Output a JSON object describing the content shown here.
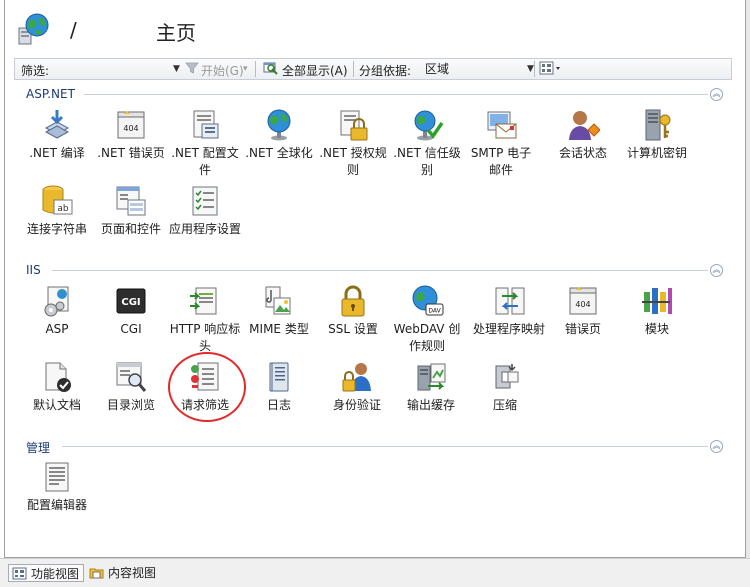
{
  "header": {
    "path": "/",
    "title": "主页"
  },
  "toolbar": {
    "filter_label": "筛选:",
    "go_label": "开始(G)",
    "show_all_label": "全部显示(A)",
    "group_by_label": "分组依据:",
    "group_by_value": "区域"
  },
  "sections": [
    {
      "title": "ASP.NET",
      "items": [
        {
          "label": ".NET 编译",
          "icon": "net-compile-icon"
        },
        {
          "label": ".NET 错误页",
          "icon": "net-error-pages-icon"
        },
        {
          "label": ".NET 配置文件",
          "icon": "net-profile-icon"
        },
        {
          "label": ".NET 全球化",
          "icon": "net-globalization-icon"
        },
        {
          "label": ".NET 授权规则",
          "icon": "net-authorization-icon"
        },
        {
          "label": ".NET 信任级别",
          "icon": "net-trust-levels-icon"
        },
        {
          "label": "SMTP 电子邮件",
          "icon": "smtp-email-icon"
        },
        {
          "label": "会话状态",
          "icon": "session-state-icon"
        },
        {
          "label": "计算机密钥",
          "icon": "machine-key-icon"
        },
        {
          "label": "连接字符串",
          "icon": "connection-strings-icon"
        },
        {
          "label": "页面和控件",
          "icon": "pages-controls-icon"
        },
        {
          "label": "应用程序设置",
          "icon": "app-settings-icon"
        }
      ]
    },
    {
      "title": "IIS",
      "items": [
        {
          "label": "ASP",
          "icon": "asp-icon"
        },
        {
          "label": "CGI",
          "icon": "cgi-icon"
        },
        {
          "label": "HTTP 响应标头",
          "icon": "http-response-headers-icon"
        },
        {
          "label": "MIME 类型",
          "icon": "mime-types-icon"
        },
        {
          "label": "SSL 设置",
          "icon": "ssl-settings-icon"
        },
        {
          "label": "WebDAV 创作规则",
          "icon": "webdav-icon"
        },
        {
          "label": "处理程序映射",
          "icon": "handler-mappings-icon"
        },
        {
          "label": "错误页",
          "icon": "error-pages-icon"
        },
        {
          "label": "模块",
          "icon": "modules-icon"
        },
        {
          "label": "默认文档",
          "icon": "default-document-icon"
        },
        {
          "label": "目录浏览",
          "icon": "directory-browsing-icon"
        },
        {
          "label": "请求筛选",
          "icon": "request-filtering-icon"
        },
        {
          "label": "日志",
          "icon": "logging-icon"
        },
        {
          "label": "身份验证",
          "icon": "authentication-icon"
        },
        {
          "label": "输出缓存",
          "icon": "output-caching-icon"
        },
        {
          "label": "压缩",
          "icon": "compression-icon"
        }
      ]
    },
    {
      "title": "管理",
      "items": [
        {
          "label": "配置编辑器",
          "icon": "configuration-editor-icon"
        }
      ]
    }
  ],
  "bottom_tabs": [
    {
      "label": "功能视图",
      "active": true
    },
    {
      "label": "内容视图",
      "active": false
    }
  ],
  "colors": {
    "section_title": "#1d3b73",
    "highlight": "#e22a2a"
  }
}
